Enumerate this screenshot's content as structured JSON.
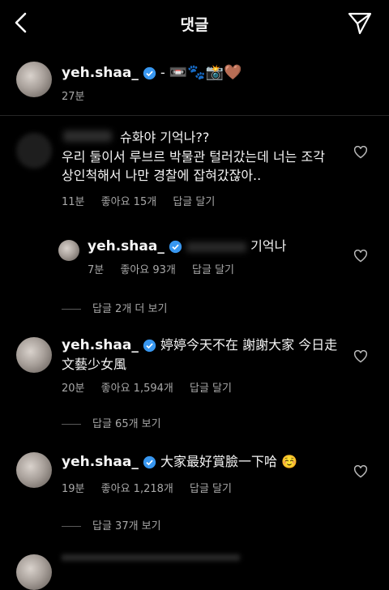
{
  "header": {
    "title": "댓글"
  },
  "caption": {
    "username": "yeh.shaa_",
    "separator": " - ",
    "emoji": "📼🐾📸🤎",
    "time": "27분"
  },
  "comments": [
    {
      "username": "",
      "line1": "슈화야 기억나??",
      "line2": "우리 둘이서 루브르 박물관 털러갔는데 너는 조각",
      "line3": "상인척해서 나만 경찰에 잡혀갔잖아..",
      "time": "11분",
      "likes": "좋아요 15개",
      "reply": "답글 달기"
    },
    {
      "username": "yeh.shaa_",
      "text": "기억나",
      "time": "7분",
      "likes": "좋아요 93개",
      "reply": "답글 달기"
    },
    {
      "view_replies": "답글 2개 더 보기"
    },
    {
      "username": "yeh.shaa_",
      "line1": "婷婷今天不在 謝謝大家 今日走",
      "line2": "文藝少女風",
      "time": "20분",
      "likes": "좋아요 1,594개",
      "reply": "답글 달기",
      "view_replies": "답글 65개 보기"
    },
    {
      "username": "yeh.shaa_",
      "text": "大家最好賞臉一下哈 ☺️",
      "time": "19분",
      "likes": "좋아요 1,218개",
      "reply": "답글 달기",
      "view_replies": "답글 37개 보기"
    }
  ],
  "colors": {
    "background": "#000000",
    "verified": "#3897f0",
    "secondary_text": "#a8a8a8"
  },
  "icons": [
    "back-chevron-icon",
    "send-paper-plane-icon",
    "verified-badge-icon",
    "heart-outline-icon"
  ]
}
